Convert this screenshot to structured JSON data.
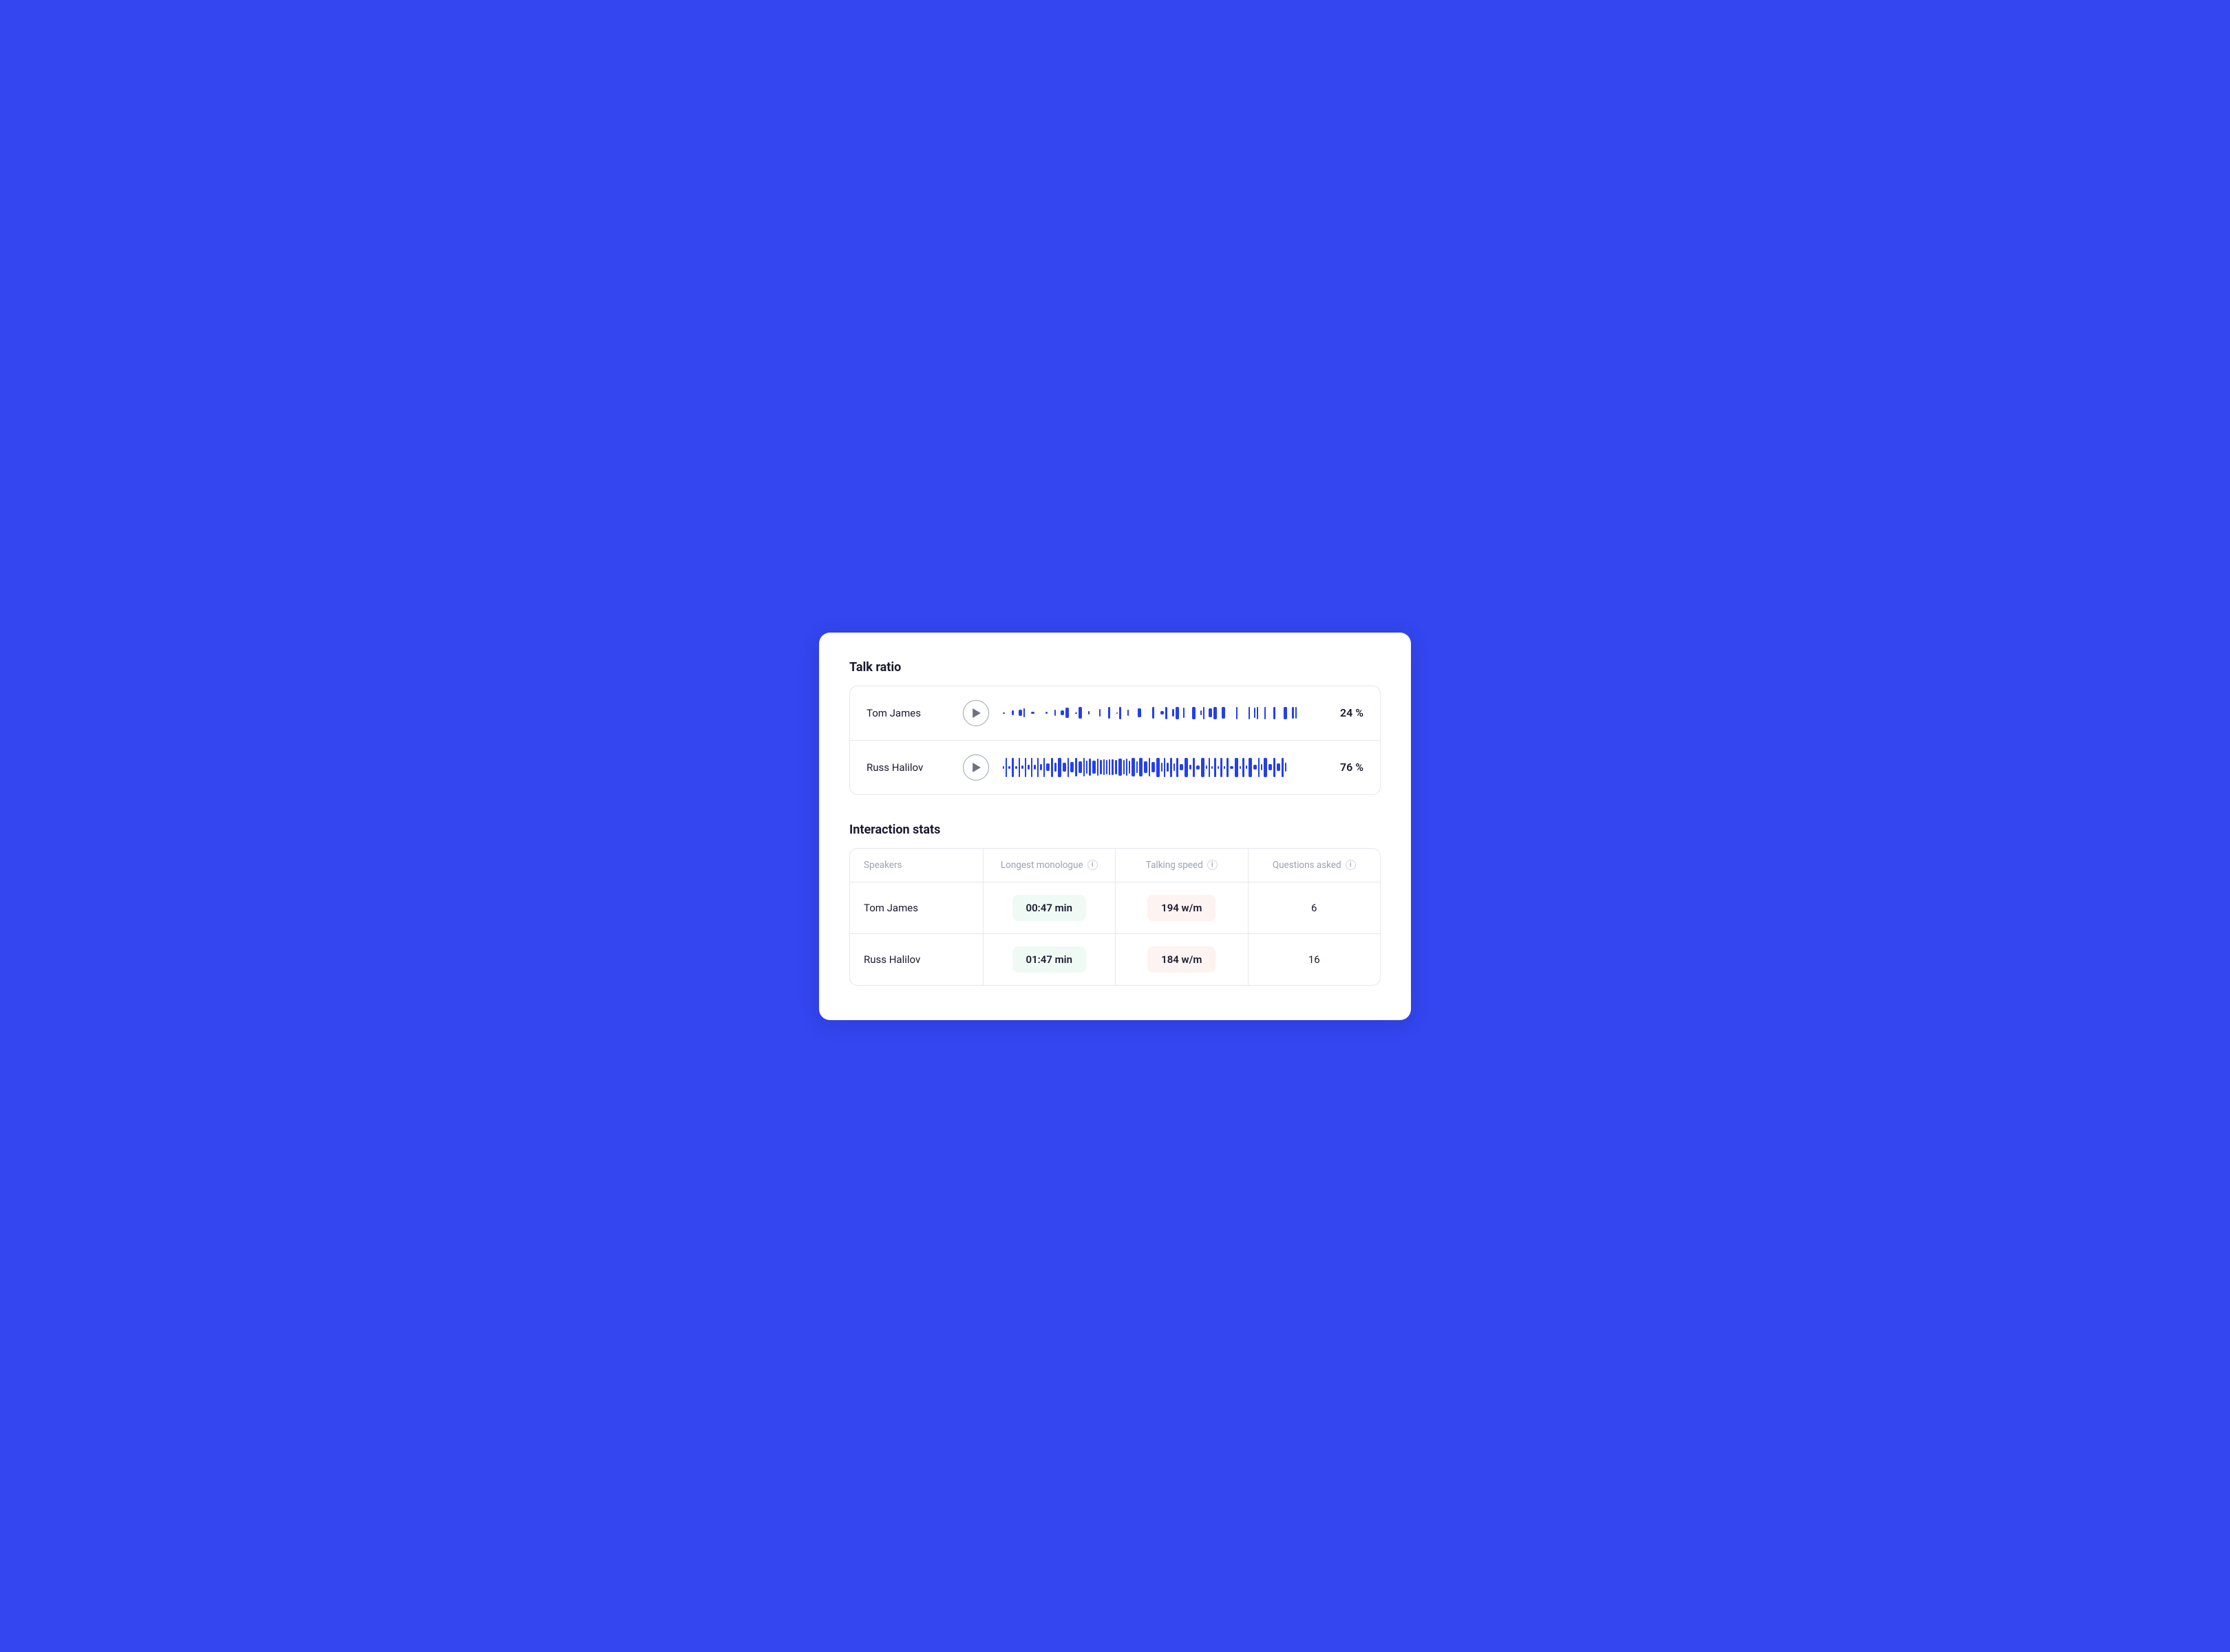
{
  "talk_ratio": {
    "title": "Talk ratio",
    "speakers": [
      {
        "name": "Tom James",
        "percentage": "24 %",
        "waveform_density": "low"
      },
      {
        "name": "Russ Halilov",
        "percentage": "76 %",
        "waveform_density": "high"
      }
    ]
  },
  "interaction_stats": {
    "title": "Interaction stats",
    "columns": {
      "speakers": "Speakers",
      "longest_monologue": "Longest monologue",
      "talking_speed": "Talking speed",
      "questions_asked": "Questions asked"
    },
    "rows": [
      {
        "name": "Tom James",
        "longest_monologue": "00:47 min",
        "talking_speed": "194 w/m",
        "questions_asked": "6"
      },
      {
        "name": "Russ Halilov",
        "longest_monologue": "01:47 min",
        "talking_speed": "184 w/m",
        "questions_asked": "16"
      }
    ]
  }
}
